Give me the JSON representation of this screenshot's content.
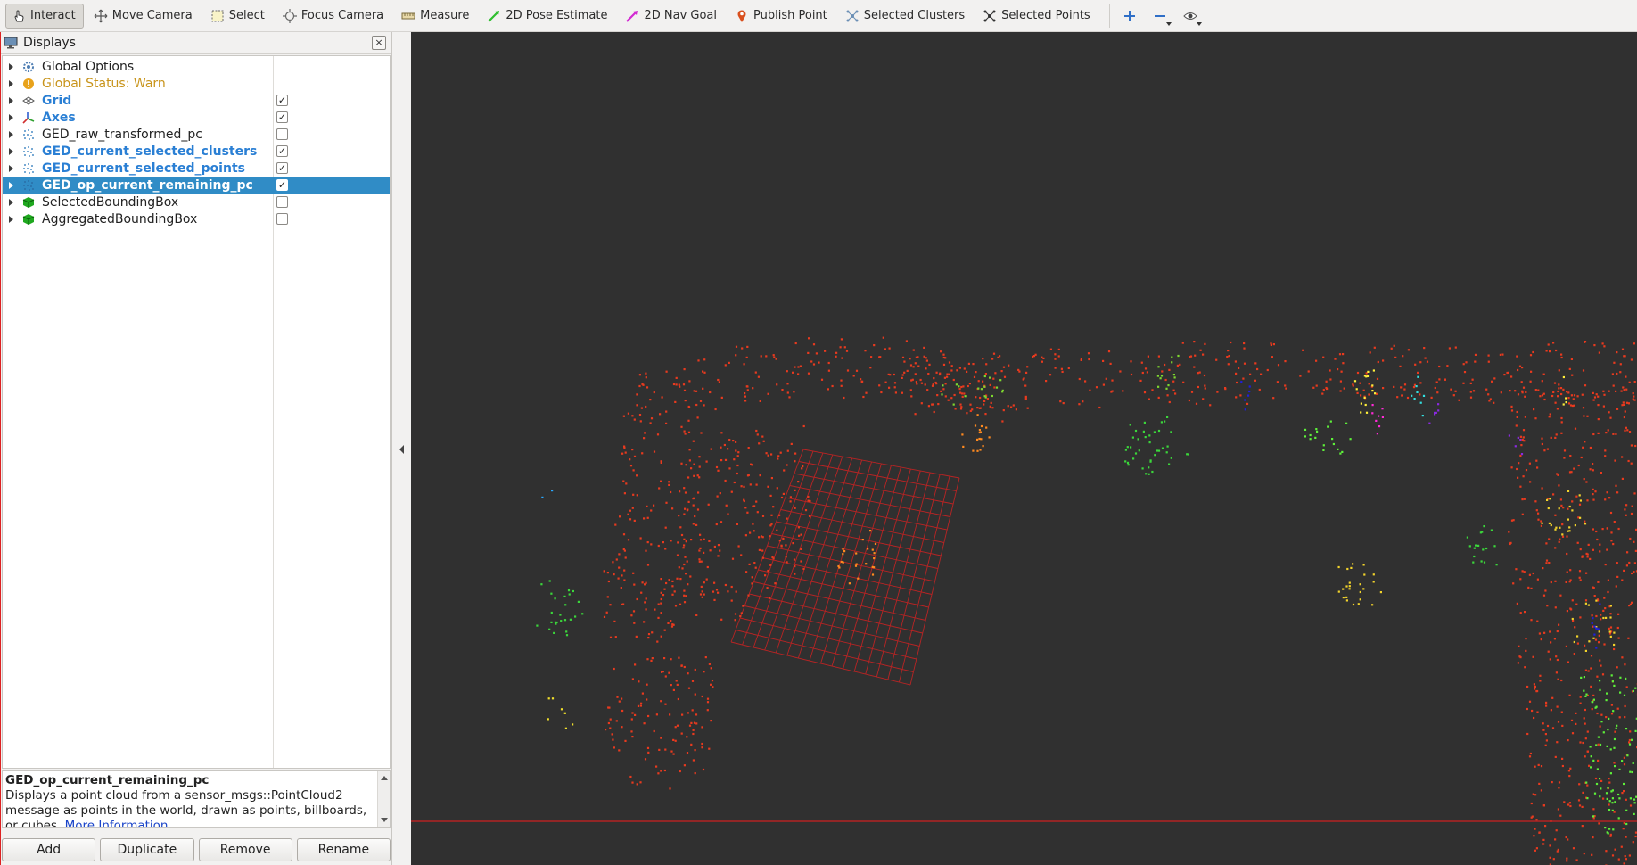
{
  "toolbar": {
    "tools": [
      {
        "label": "Interact",
        "icon": "pointer-hand-icon",
        "active": true
      },
      {
        "label": "Move Camera",
        "icon": "move-camera-icon",
        "active": false
      },
      {
        "label": "Select",
        "icon": "select-box-icon",
        "active": false
      },
      {
        "label": "Focus Camera",
        "icon": "focus-crosshair-icon",
        "active": false
      },
      {
        "label": "Measure",
        "icon": "ruler-icon",
        "active": false
      },
      {
        "label": "2D Pose Estimate",
        "icon": "green-arrow-icon",
        "active": false
      },
      {
        "label": "2D Nav Goal",
        "icon": "magenta-arrow-icon",
        "active": false
      },
      {
        "label": "Publish Point",
        "icon": "map-pin-icon",
        "active": false
      },
      {
        "label": "Selected Clusters",
        "icon": "clusters-icon",
        "active": false
      },
      {
        "label": "Selected Points",
        "icon": "points-icon",
        "active": false
      }
    ],
    "icon_tools": [
      "add-tool-icon",
      "remove-tool-icon",
      "eye-visibility-icon"
    ]
  },
  "panel": {
    "title": "Displays",
    "close_label": "×",
    "items": [
      {
        "label": "Global Options",
        "style": "normal",
        "icon": "gear-icon",
        "checkbox": null
      },
      {
        "label": "Global Status: Warn",
        "style": "warn",
        "icon": "warning-icon",
        "checkbox": null
      },
      {
        "label": "Grid",
        "style": "blue",
        "icon": "grid-icon",
        "checkbox": "✓"
      },
      {
        "label": "Axes",
        "style": "blue",
        "icon": "axes-icon",
        "checkbox": "✓"
      },
      {
        "label": "GED_raw_transformed_pc",
        "style": "normal",
        "icon": "pointcloud-icon",
        "checkbox": ""
      },
      {
        "label": "GED_current_selected_clusters",
        "style": "blue",
        "icon": "pointcloud-icon",
        "checkbox": "✓"
      },
      {
        "label": "GED_current_selected_points",
        "style": "blue",
        "icon": "pointcloud-icon",
        "checkbox": "✓"
      },
      {
        "label": "GED_op_current_remaining_pc",
        "style": "selected",
        "icon": "pointcloud-icon",
        "checkbox": "✓"
      },
      {
        "label": "SelectedBoundingBox",
        "style": "normal",
        "icon": "green-cube-icon",
        "checkbox": ""
      },
      {
        "label": "AggregatedBoundingBox",
        "style": "normal",
        "icon": "green-cube-icon",
        "checkbox": ""
      }
    ],
    "description": {
      "title": "GED_op_current_remaining_pc",
      "text": "Displays a point cloud from a sensor_msgs::PointCloud2 message as points in the world, drawn as points, billboards, or cubes.",
      "link": "More Information",
      "suffix": "."
    },
    "buttons": [
      "Add",
      "Duplicate",
      "Remove",
      "Rename"
    ]
  },
  "colors": {
    "background_3d": "#303030",
    "cloud_red": "#e83a1e",
    "grid": "#b82424",
    "selection_blue": "#308cc6",
    "warn": "#c8941b"
  }
}
